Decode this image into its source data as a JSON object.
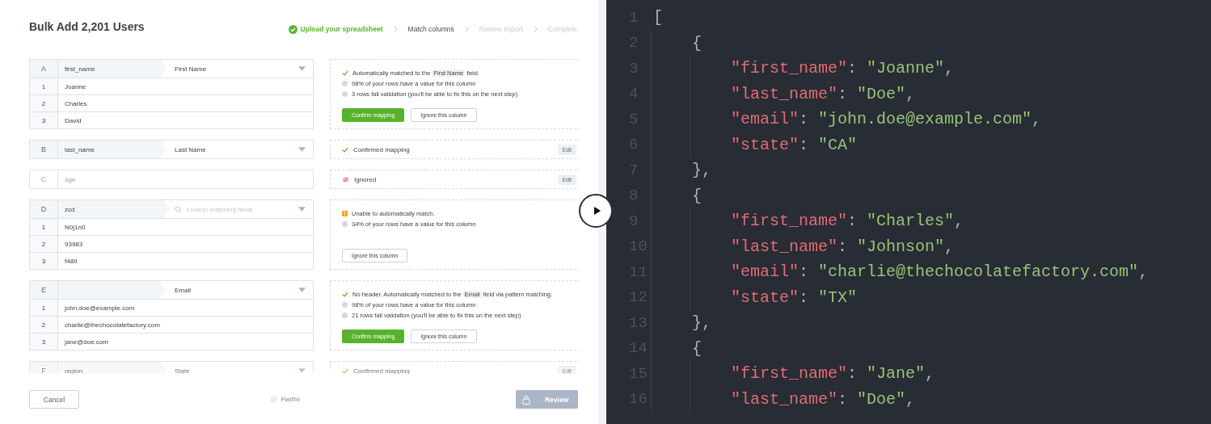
{
  "title": "Bulk Add 2,201 Users",
  "steps": [
    {
      "label": "Upload your spreadsheet",
      "done": true,
      "selected": false
    },
    {
      "label": "Match columns",
      "done": false,
      "selected": true
    },
    {
      "label": "Review import",
      "done": false,
      "selected": false
    },
    {
      "label": "Complete",
      "done": false,
      "selected": false
    }
  ],
  "columns": [
    {
      "letter": "A",
      "header": "first_name",
      "ignored": false,
      "field": {
        "kind": "value",
        "text": "First Name"
      },
      "rows": [
        {
          "index": "1",
          "value": "Joanne"
        },
        {
          "index": "2",
          "value": "Charles"
        },
        {
          "index": "3",
          "value": "David"
        }
      ],
      "status": {
        "kind": "review",
        "messages": [
          {
            "kind": "check",
            "parts": [
              {
                "text": "Automatically matched to the ",
                "highlight": false
              },
              {
                "text": "First Name",
                "highlight": true
              },
              {
                "text": " field",
                "highlight": false
              }
            ]
          },
          {
            "kind": "dot",
            "parts": [
              {
                "text": "98% of your rows have a value for this column",
                "highlight": false
              }
            ]
          },
          {
            "kind": "dot",
            "parts": [
              {
                "text": "3 rows fail validation (you'll be able to fix this on the next step)",
                "highlight": false
              }
            ]
          }
        ],
        "buttons": [
          {
            "label": "Confirm mapping",
            "kind": "primary"
          },
          {
            "label": "Ignore this column",
            "kind": "secondary"
          }
        ]
      }
    },
    {
      "letter": "B",
      "header": "last_name",
      "ignored": false,
      "field": {
        "kind": "value",
        "text": "Last Name"
      },
      "status": {
        "kind": "confirmed",
        "label": "Confirmed mapping",
        "button": "Edit"
      }
    },
    {
      "letter": "C",
      "header": "age",
      "ignored": true,
      "status": {
        "kind": "ignored",
        "label": "Ignored",
        "button": "Edit"
      }
    },
    {
      "letter": "D",
      "header": "zcd",
      "ignored": false,
      "field": {
        "kind": "search",
        "placeholder": "Lookup matching fields"
      },
      "rows": [
        {
          "index": "1",
          "value": "N0j1n0"
        },
        {
          "index": "2",
          "value": "93983"
        },
        {
          "index": "3",
          "value": "f489"
        }
      ],
      "status": {
        "kind": "review",
        "messages": [
          {
            "kind": "warning",
            "parts": [
              {
                "text": "Unable to automatically match.",
                "highlight": false
              }
            ]
          },
          {
            "kind": "dot",
            "parts": [
              {
                "text": "34% of your rows have a value for this column",
                "highlight": false
              }
            ]
          }
        ],
        "buttons": [
          {
            "label": "Ignore this column",
            "kind": "secondary"
          }
        ]
      }
    },
    {
      "letter": "E",
      "ignored": false,
      "field": {
        "kind": "value",
        "text": "Email"
      },
      "rows": [
        {
          "index": "1",
          "value": "john.doe@example.com"
        },
        {
          "index": "2",
          "value": "charlie@thechocolatefactory.com"
        },
        {
          "index": "3",
          "value": "jane@doe.com"
        }
      ],
      "status": {
        "kind": "review",
        "messages": [
          {
            "kind": "check",
            "parts": [
              {
                "text": "No header. Automatically matched to the ",
                "highlight": false
              },
              {
                "text": "Email",
                "highlight": true
              },
              {
                "text": " field via pattern matching.",
                "highlight": false
              }
            ]
          },
          {
            "kind": "dot",
            "parts": [
              {
                "text": "98% of your rows have a value for this column",
                "highlight": false
              }
            ]
          },
          {
            "kind": "dot",
            "parts": [
              {
                "text": "21 rows fail validation (you'll be able to fix this on the next step)",
                "highlight": false
              }
            ]
          }
        ],
        "buttons": [
          {
            "label": "Confirm mapping",
            "kind": "primary"
          },
          {
            "label": "Ignore this column",
            "kind": "secondary"
          }
        ]
      }
    },
    {
      "letter": "F",
      "header": "region",
      "ignored": false,
      "field": {
        "kind": "value",
        "text": "State"
      },
      "status": {
        "kind": "confirmed",
        "label": "Confirmed mapping",
        "button": "Edit"
      }
    }
  ],
  "footer": {
    "cancel": "Cancel",
    "brand": "Flatfile",
    "review": {
      "label": "Review",
      "disabled": true
    }
  },
  "code": {
    "lines": [
      {
        "number": "1",
        "tokens": [
          {
            "kind": "punct",
            "text": "["
          }
        ]
      },
      {
        "number": "2",
        "tokens": [
          {
            "kind": "punct",
            "text": "    {"
          }
        ]
      },
      {
        "number": "3",
        "tokens": [
          {
            "kind": "key",
            "text": "        \"first_name\""
          },
          {
            "kind": "punct",
            "text": ": "
          },
          {
            "kind": "string",
            "text": "\"Joanne\""
          },
          {
            "kind": "punct",
            "text": ","
          }
        ]
      },
      {
        "number": "4",
        "tokens": [
          {
            "kind": "key",
            "text": "        \"last_name\""
          },
          {
            "kind": "punct",
            "text": ": "
          },
          {
            "kind": "string",
            "text": "\"Doe\""
          },
          {
            "kind": "punct",
            "text": ","
          }
        ]
      },
      {
        "number": "5",
        "tokens": [
          {
            "kind": "key",
            "text": "        \"email\""
          },
          {
            "kind": "punct",
            "text": ": "
          },
          {
            "kind": "string",
            "text": "\"john.doe@example.com\""
          },
          {
            "kind": "punct",
            "text": ","
          }
        ]
      },
      {
        "number": "6",
        "tokens": [
          {
            "kind": "key",
            "text": "        \"state\""
          },
          {
            "kind": "punct",
            "text": ": "
          },
          {
            "kind": "string",
            "text": "\"CA\""
          }
        ]
      },
      {
        "number": "7",
        "tokens": [
          {
            "kind": "punct",
            "text": "    },"
          }
        ]
      },
      {
        "number": "8",
        "tokens": [
          {
            "kind": "punct",
            "text": "    {"
          }
        ]
      },
      {
        "number": "9",
        "tokens": [
          {
            "kind": "key",
            "text": "        \"first_name\""
          },
          {
            "kind": "punct",
            "text": ": "
          },
          {
            "kind": "string",
            "text": "\"Charles\""
          },
          {
            "kind": "punct",
            "text": ","
          }
        ]
      },
      {
        "number": "10",
        "tokens": [
          {
            "kind": "key",
            "text": "        \"last_name\""
          },
          {
            "kind": "punct",
            "text": ": "
          },
          {
            "kind": "string",
            "text": "\"Johnson\""
          },
          {
            "kind": "punct",
            "text": ","
          }
        ]
      },
      {
        "number": "11",
        "tokens": [
          {
            "kind": "key",
            "text": "        \"email\""
          },
          {
            "kind": "punct",
            "text": ": "
          },
          {
            "kind": "string",
            "text": "\"charlie@thechocolatefactory.com\""
          },
          {
            "kind": "punct",
            "text": ","
          }
        ]
      },
      {
        "number": "12",
        "tokens": [
          {
            "kind": "key",
            "text": "        \"state\""
          },
          {
            "kind": "punct",
            "text": ": "
          },
          {
            "kind": "string",
            "text": "\"TX\""
          }
        ]
      },
      {
        "number": "13",
        "tokens": [
          {
            "kind": "punct",
            "text": "    },"
          }
        ]
      },
      {
        "number": "14",
        "tokens": [
          {
            "kind": "punct",
            "text": "    {"
          }
        ]
      },
      {
        "number": "15",
        "tokens": [
          {
            "kind": "key",
            "text": "        \"first_name\""
          },
          {
            "kind": "punct",
            "text": ": "
          },
          {
            "kind": "string",
            "text": "\"Jane\""
          },
          {
            "kind": "punct",
            "text": ","
          }
        ]
      },
      {
        "number": "16",
        "tokens": [
          {
            "kind": "key",
            "text": "        \"last_name\""
          },
          {
            "kind": "punct",
            "text": ": "
          },
          {
            "kind": "string",
            "text": "\"Doe\""
          },
          {
            "kind": "punct",
            "text": ","
          }
        ]
      }
    ]
  }
}
